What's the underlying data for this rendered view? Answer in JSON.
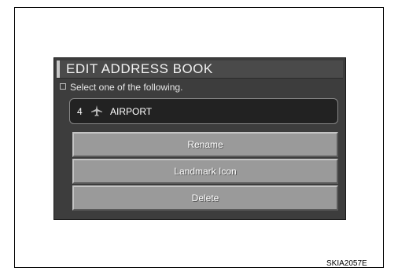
{
  "screen": {
    "title": "EDIT ADDRESS BOOK",
    "prompt": "Select one of the following.",
    "selected_item": {
      "number": "4",
      "icon": "airplane-icon",
      "name": "AIRPORT"
    },
    "buttons": [
      {
        "label": "Rename"
      },
      {
        "label": "Landmark Icon"
      },
      {
        "label": "Delete"
      }
    ]
  },
  "caption": "SKIA2057E"
}
